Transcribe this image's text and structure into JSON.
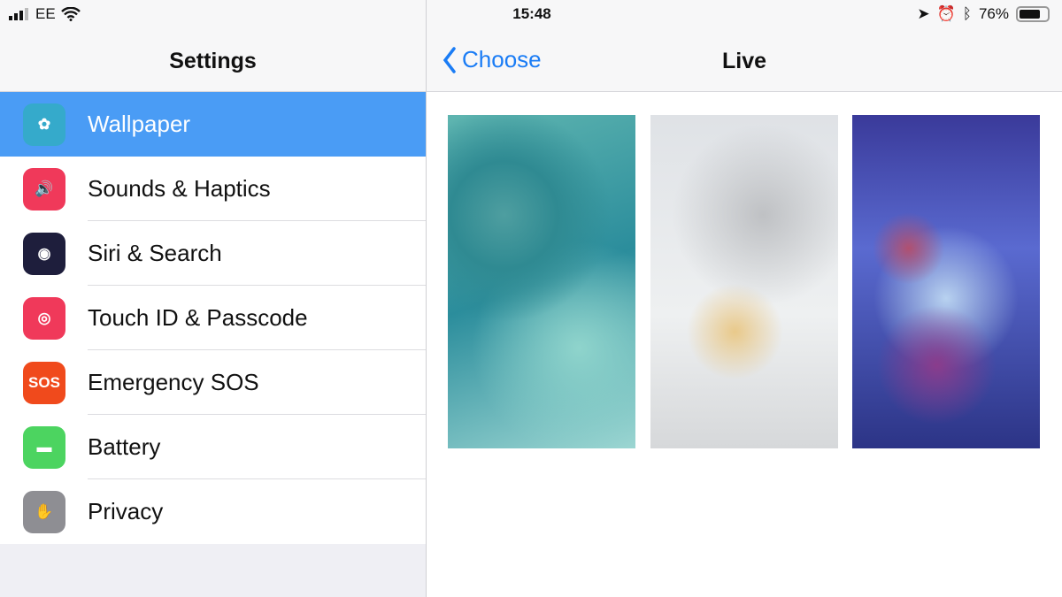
{
  "status_bar": {
    "carrier": "EE",
    "time": "15:48",
    "battery": "76%",
    "battery_level": 0.76
  },
  "left": {
    "title": "Settings",
    "items": [
      {
        "label": "Wallpaper",
        "icon": "wallpaper-flower-icon",
        "color": "#35aacb",
        "selected": true
      },
      {
        "label": "Sounds & Haptics",
        "icon": "speaker-icon",
        "color": "#f0395a"
      },
      {
        "label": "Siri & Search",
        "icon": "siri-icon",
        "color": "#1e1e3c"
      },
      {
        "label": "Touch ID & Passcode",
        "icon": "fingerprint-icon",
        "color": "#f0395a"
      },
      {
        "label": "Emergency SOS",
        "icon": "sos-icon",
        "color": "#f04a1c",
        "icon_text": "SOS"
      },
      {
        "label": "Battery",
        "icon": "battery-icon",
        "color": "#4cd460"
      },
      {
        "label": "Privacy",
        "icon": "hand-icon",
        "color": "#8e8e93"
      }
    ]
  },
  "right": {
    "back_label": "Choose",
    "title": "Live",
    "wallpapers": [
      "teal smoke",
      "white smoke",
      "purple smoke"
    ]
  },
  "colors": {
    "accent": "#1a7cf5",
    "selected": "#4a9cf5"
  }
}
